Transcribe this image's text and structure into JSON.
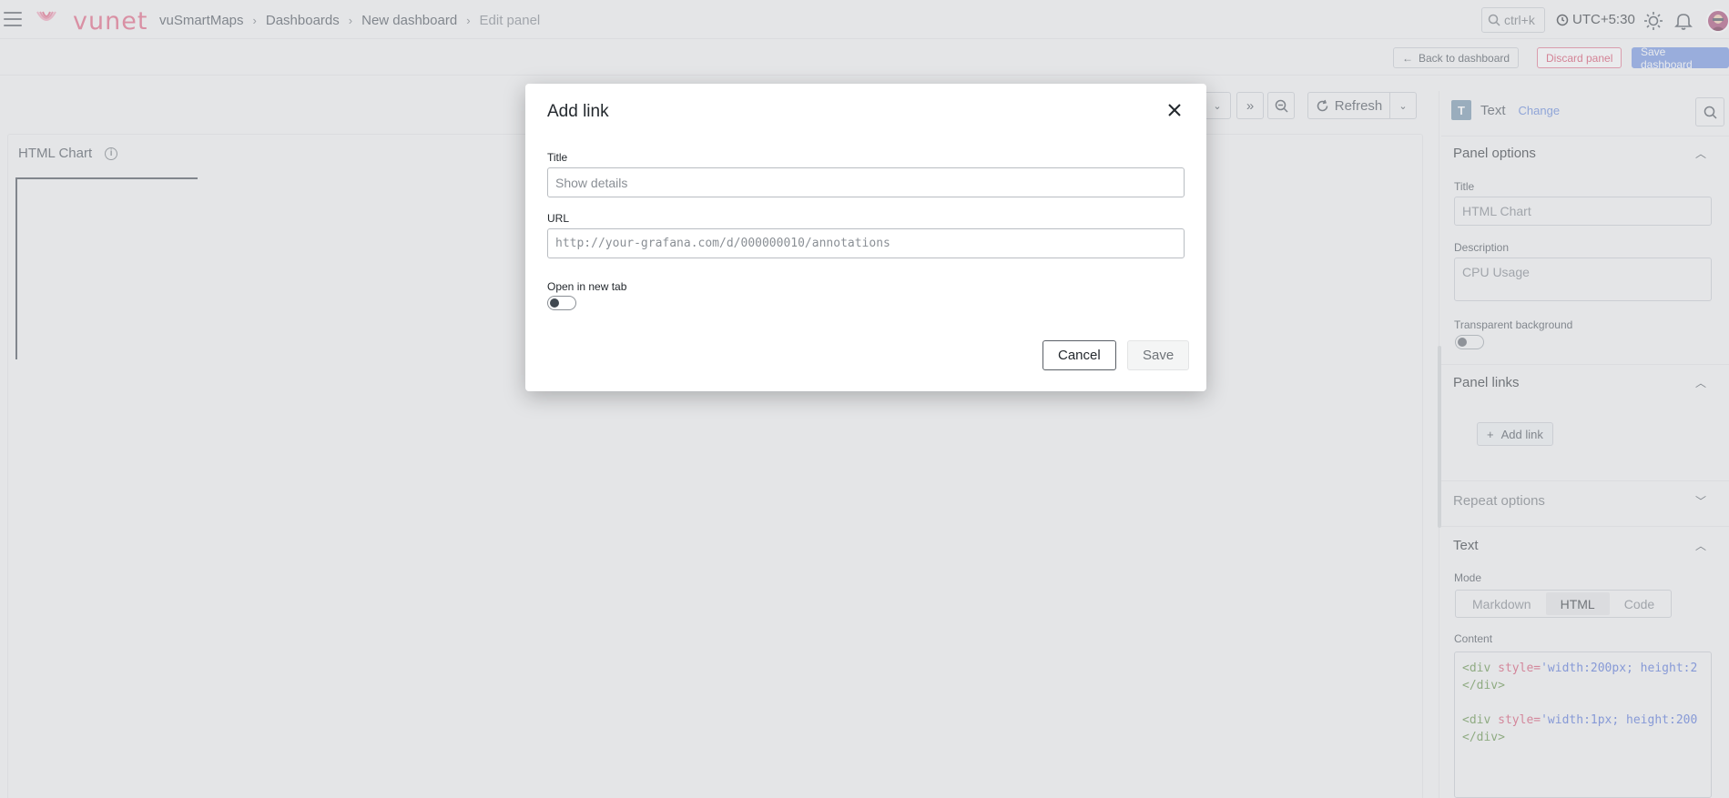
{
  "app": {
    "brand": "vunet",
    "breadcrumb": [
      "vuSmartMaps",
      "Dashboards",
      "New dashboard",
      "Edit panel"
    ],
    "search_placeholder": "ctrl+k",
    "timezone": "UTC+5:30"
  },
  "actions": {
    "back": "Back to dashboard",
    "discard": "Discard panel",
    "save_dashboard": "Save dashboard"
  },
  "toolbar": {
    "refresh": "Refresh"
  },
  "panel": {
    "title": "HTML Chart"
  },
  "sidebar": {
    "visualization": "Text",
    "change": "Change",
    "panel_options": {
      "header": "Panel options",
      "title_label": "Title",
      "title_value": "HTML Chart",
      "description_label": "Description",
      "description_value": "CPU Usage",
      "transparent_label": "Transparent background"
    },
    "panel_links": {
      "header": "Panel links",
      "add_link": "Add link"
    },
    "repeat_options": {
      "header": "Repeat options"
    },
    "text": {
      "header": "Text",
      "mode_label": "Mode",
      "modes": [
        "Markdown",
        "HTML",
        "Code"
      ],
      "active_mode": "HTML",
      "content_label": "Content",
      "code_lines": [
        {
          "tag_open": "<div",
          "attr": " style=",
          "str": "'width:200px; height:2"
        },
        {
          "tag_close": "</div>"
        },
        {
          "tag_open": "<div",
          "attr": " style=",
          "str": "'width:1px; height:200"
        },
        {
          "tag_close": "</div>"
        }
      ]
    }
  },
  "modal": {
    "title": "Add link",
    "title_label": "Title",
    "title_placeholder": "Show details",
    "url_label": "URL",
    "url_placeholder": "http://your-grafana.com/d/000000010/annotations",
    "new_tab_label": "Open in new tab",
    "cancel": "Cancel",
    "save": "Save"
  },
  "colors": {
    "brand": "#e05a7a",
    "primary": "#6c8fe0",
    "destructive": "#d6405f"
  }
}
